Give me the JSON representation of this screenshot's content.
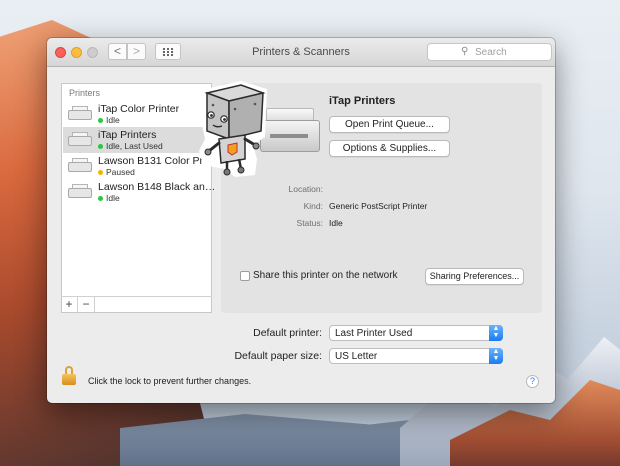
{
  "window": {
    "title": "Printers & Scanners",
    "search_placeholder": "Search",
    "nav_back": "<",
    "nav_forward": ">"
  },
  "printers": {
    "header": "Printers",
    "items": [
      {
        "name": "iTap Color Printer",
        "status": "Idle",
        "status_color": "#28c840",
        "selected": false
      },
      {
        "name": "iTap Printers",
        "status": "Idle, Last Used",
        "status_color": "#28c840",
        "selected": true
      },
      {
        "name": "Lawson B131 Color Pri…",
        "status": "Paused",
        "status_color": "#f5b400",
        "selected": false
      },
      {
        "name": "Lawson B148 Black an…",
        "status": "Idle",
        "status_color": "#28c840",
        "selected": false
      }
    ],
    "add_label": "+",
    "remove_label": "−"
  },
  "detail": {
    "name": "iTap Printers",
    "open_queue_label": "Open Print Queue...",
    "options_label": "Options & Supplies...",
    "location_label": "Location:",
    "location_value": "",
    "kind_label": "Kind:",
    "kind_value": "Generic PostScript Printer",
    "status_label": "Status:",
    "status_value": "Idle",
    "share_label": "Share this printer on the network",
    "sharing_prefs_label": "Sharing Preferences..."
  },
  "defaults": {
    "printer_label": "Default printer:",
    "printer_value": "Last Printer Used",
    "paper_label": "Default paper size:",
    "paper_value": "US Letter"
  },
  "footer": {
    "lock_text": "Click the lock to prevent further changes.",
    "help_label": "?"
  },
  "colors": {
    "accent": "#197cf1",
    "close": "#fc605c",
    "minimize": "#fdbc40"
  }
}
